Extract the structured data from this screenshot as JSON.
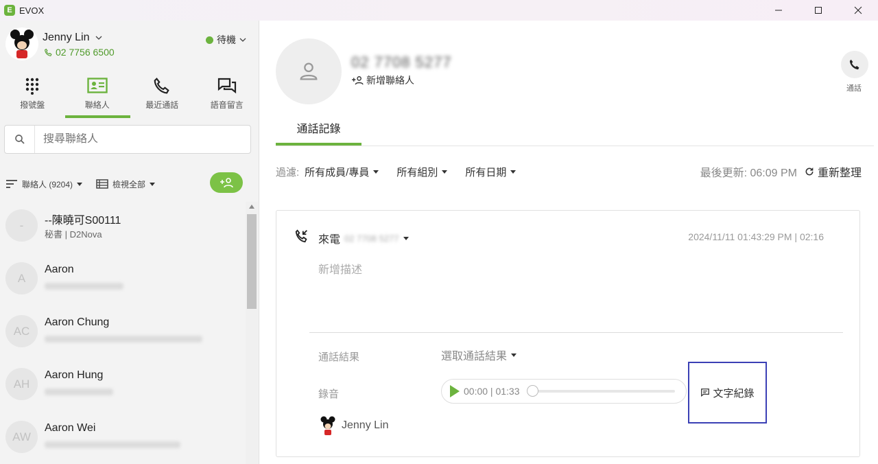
{
  "window": {
    "title": "EVOX",
    "logo_letter": "E"
  },
  "user": {
    "name": "Jenny Lin",
    "phone": "02 7756 6500",
    "status": "待機"
  },
  "nav": {
    "tabs": [
      {
        "label": "撥號盤",
        "icon": "dialpad-icon"
      },
      {
        "label": "聯絡人",
        "icon": "contact-card-icon",
        "active": true
      },
      {
        "label": "最近通話",
        "icon": "phone-icon"
      },
      {
        "label": "語音留言",
        "icon": "voicemail-chat-icon"
      }
    ]
  },
  "search": {
    "placeholder": "搜尋聯絡人"
  },
  "list_controls": {
    "contacts_filter": "聯絡人 (9204)",
    "view_filter": "檢視全部"
  },
  "contacts": [
    {
      "initials": "-",
      "name": "--陳曉可S00111",
      "sub": "秘書 | D2Nova"
    },
    {
      "initials": "A",
      "name": "Aaron",
      "sub": ""
    },
    {
      "initials": "AC",
      "name": "Aaron Chung",
      "sub": ""
    },
    {
      "initials": "AH",
      "name": "Aaron Hung",
      "sub": ""
    },
    {
      "initials": "AW",
      "name": "Aaron Wei",
      "sub": ""
    }
  ],
  "detail": {
    "number_blurred": "02 7708 5277",
    "add_contact": "新增聯絡人",
    "call_label": "通話",
    "tab": "通話記錄",
    "filters": {
      "label": "過濾:",
      "members": "所有成員/專員",
      "groups": "所有組別",
      "dates": "所有日期"
    },
    "last_updated": "最後更新: 06:09 PM",
    "refresh": "重新整理"
  },
  "record": {
    "direction": "來電",
    "number_blurred": "02 7708 5277",
    "datetime": "2024/11/11 01:43:29 PM | 02:16",
    "description_placeholder": "新增描述",
    "result_label": "通話結果",
    "result_value": "選取通話結果",
    "recording_label": "錄音",
    "player_time": "00:00 | 01:33",
    "progress_fraction": 0,
    "transcript": "文字紀錄",
    "agent": "Jenny Lin"
  },
  "colors": {
    "accent": "#6cb33e",
    "highlight_border": "#3a3fb5"
  }
}
